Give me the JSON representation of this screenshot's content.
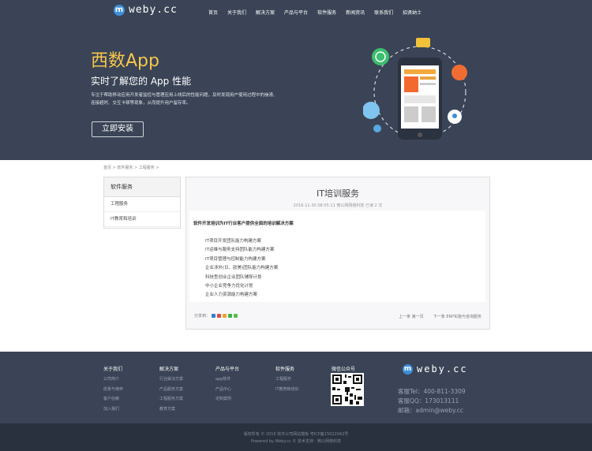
{
  "brand": {
    "logo_letter": "m",
    "name": "weby.cc"
  },
  "nav": [
    "首页",
    "关于我们",
    "解决方案",
    "产品与平台",
    "软件服务",
    "新闻资讯",
    "联系我们",
    "招贤纳士"
  ],
  "hero": {
    "title": "西数App",
    "subtitle": "实时了解您的 App 性能",
    "desc_line1": "专注于帮助移动应用开发者监控与管理应用上线后的性能问题，及时发现用户使用过程中的崩溃、",
    "desc_line2": "连接超时、交互卡顿等现象，从而提升用户留存率。",
    "button": "立即安装"
  },
  "breadcrumb": "首页 > 软件服务 > 工程服务 >",
  "sidebar": {
    "title": "软件服务",
    "items": [
      "工程服务",
      "IT教育和培训"
    ]
  },
  "article": {
    "title": "IT培训服务",
    "meta": "2016-11-30 08:55:11  微公网网络科技  已读 2 次",
    "lead": "软件开发培训为IT行业客户提供全面的培训解决方案",
    "items": [
      "IT项目开发团队能力构建方案",
      "IT运维与服务支持团队能力构建方案",
      "IT项目管理与控制能力构建方案",
      "企业涉外(日、欧美)团队能力构建方案",
      "科技型创业企业团队辅导计划",
      "中小企业竞争力优化计划",
      "企业人力资源能力构建方案"
    ],
    "share": "分享到：",
    "prev": "上一条  第一页",
    "next": "下一条  ERP实施与咨询服务"
  },
  "footer": {
    "cols": [
      {
        "title": "关于我们",
        "items": [
          "公司简介",
          "愿景与使命",
          "客户信赖",
          "加入我们"
        ]
      },
      {
        "title": "解决方案",
        "items": [
          "行业解决方案",
          "产品服务方案",
          "工程服务方案",
          "教育方案"
        ]
      },
      {
        "title": "产品与平台",
        "items": [
          "app软件",
          "产品中心",
          "定制案例"
        ]
      },
      {
        "title": "软件服务",
        "items": [
          "工程服务",
          "IT教育和培训"
        ]
      },
      {
        "title": "微信公众号",
        "items": []
      }
    ],
    "tel": "客服Tel：400-811-3309",
    "qq": "客服QQ：173013111",
    "email": "邮箱：admin@weby.cc",
    "copyright1": "版权所有 © 2016 软件公司网站模板 粤ICP备15022042号",
    "copyright2": "Powered by Weby.cc © 技术支持：微公网络科技"
  },
  "colors": {
    "header_bg": "#3a4456",
    "accent_yellow": "#f7c64b",
    "brand_blue": "#3d8fdb"
  }
}
